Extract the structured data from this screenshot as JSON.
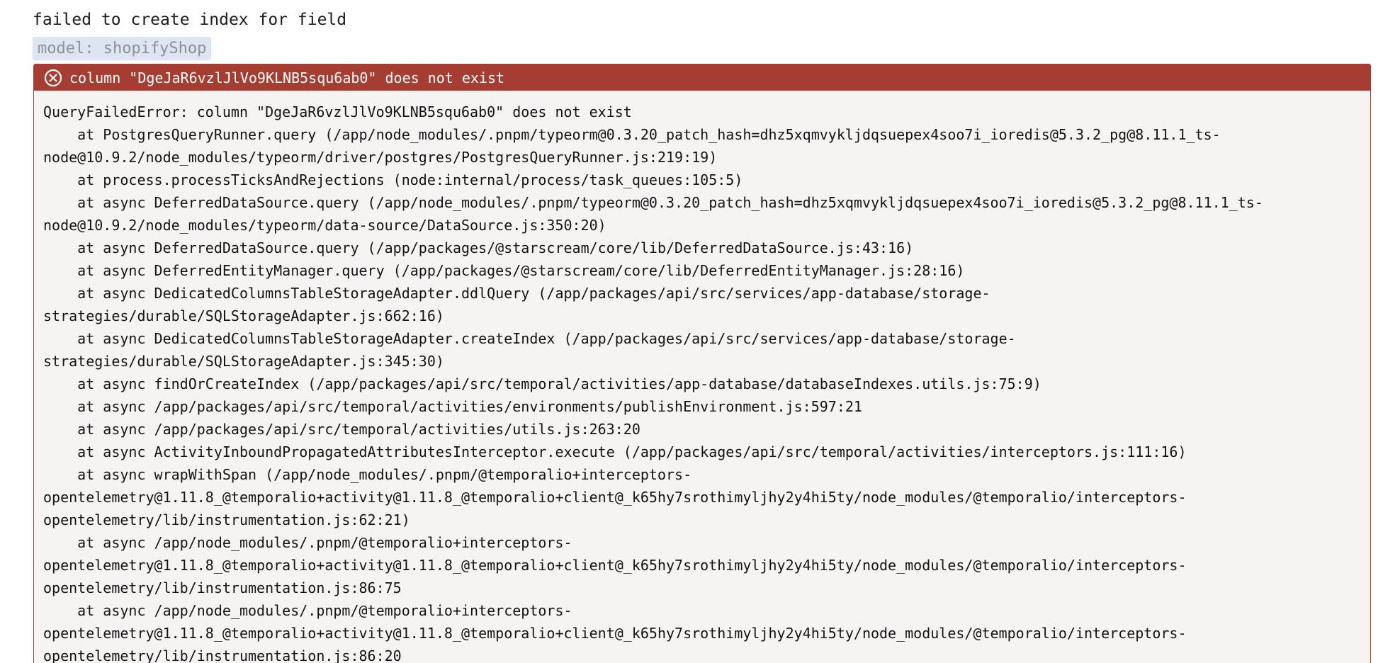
{
  "title": "failed to create index for field",
  "model_tag": "model: shopifyShop",
  "error": {
    "header_message": "column \"DgeJaR6vzlJlVo9KLNB5squ6ab0\" does not exist",
    "icon": "circle-x-icon",
    "colors": {
      "header_bg": "#a63d32",
      "panel_bg": "#f7f3f2",
      "tag_bg": "#dde5f3"
    },
    "stack_lines": [
      "QueryFailedError: column \"DgeJaR6vzlJlVo9KLNB5squ6ab0\" does not exist",
      "    at PostgresQueryRunner.query (/app/node_modules/.pnpm/typeorm@0.3.20_patch_hash=dhz5xqmvykljdqsuepex4soo7i_ioredis@5.3.2_pg@8.11.1_ts-",
      "node@10.9.2/node_modules/typeorm/driver/postgres/PostgresQueryRunner.js:219:19)",
      "    at process.processTicksAndRejections (node:internal/process/task_queues:105:5)",
      "    at async DeferredDataSource.query (/app/node_modules/.pnpm/typeorm@0.3.20_patch_hash=dhz5xqmvykljdqsuepex4soo7i_ioredis@5.3.2_pg@8.11.1_ts-",
      "node@10.9.2/node_modules/typeorm/data-source/DataSource.js:350:20)",
      "    at async DeferredDataSource.query (/app/packages/@starscream/core/lib/DeferredDataSource.js:43:16)",
      "    at async DeferredEntityManager.query (/app/packages/@starscream/core/lib/DeferredEntityManager.js:28:16)",
      "    at async DedicatedColumnsTableStorageAdapter.ddlQuery (/app/packages/api/src/services/app-database/storage-",
      "strategies/durable/SQLStorageAdapter.js:662:16)",
      "    at async DedicatedColumnsTableStorageAdapter.createIndex (/app/packages/api/src/services/app-database/storage-",
      "strategies/durable/SQLStorageAdapter.js:345:30)",
      "    at async findOrCreateIndex (/app/packages/api/src/temporal/activities/app-database/databaseIndexes.utils.js:75:9)",
      "    at async /app/packages/api/src/temporal/activities/environments/publishEnvironment.js:597:21",
      "    at async /app/packages/api/src/temporal/activities/utils.js:263:20",
      "    at async ActivityInboundPropagatedAttributesInterceptor.execute (/app/packages/api/src/temporal/activities/interceptors.js:111:16)",
      "    at async wrapWithSpan (/app/node_modules/.pnpm/@temporalio+interceptors-",
      "opentelemetry@1.11.8_@temporalio+activity@1.11.8_@temporalio+client@_k65hy7srothimyljhy2y4hi5ty/node_modules/@temporalio/interceptors-",
      "opentelemetry/lib/instrumentation.js:62:21)",
      "    at async /app/node_modules/.pnpm/@temporalio+interceptors-",
      "opentelemetry@1.11.8_@temporalio+activity@1.11.8_@temporalio+client@_k65hy7srothimyljhy2y4hi5ty/node_modules/@temporalio/interceptors-",
      "opentelemetry/lib/instrumentation.js:86:75",
      "    at async /app/node_modules/.pnpm/@temporalio+interceptors-",
      "opentelemetry@1.11.8_@temporalio+activity@1.11.8_@temporalio+client@_k65hy7srothimyljhy2y4hi5ty/node_modules/@temporalio/interceptors-",
      "opentelemetry/lib/instrumentation.js:86:20"
    ]
  }
}
